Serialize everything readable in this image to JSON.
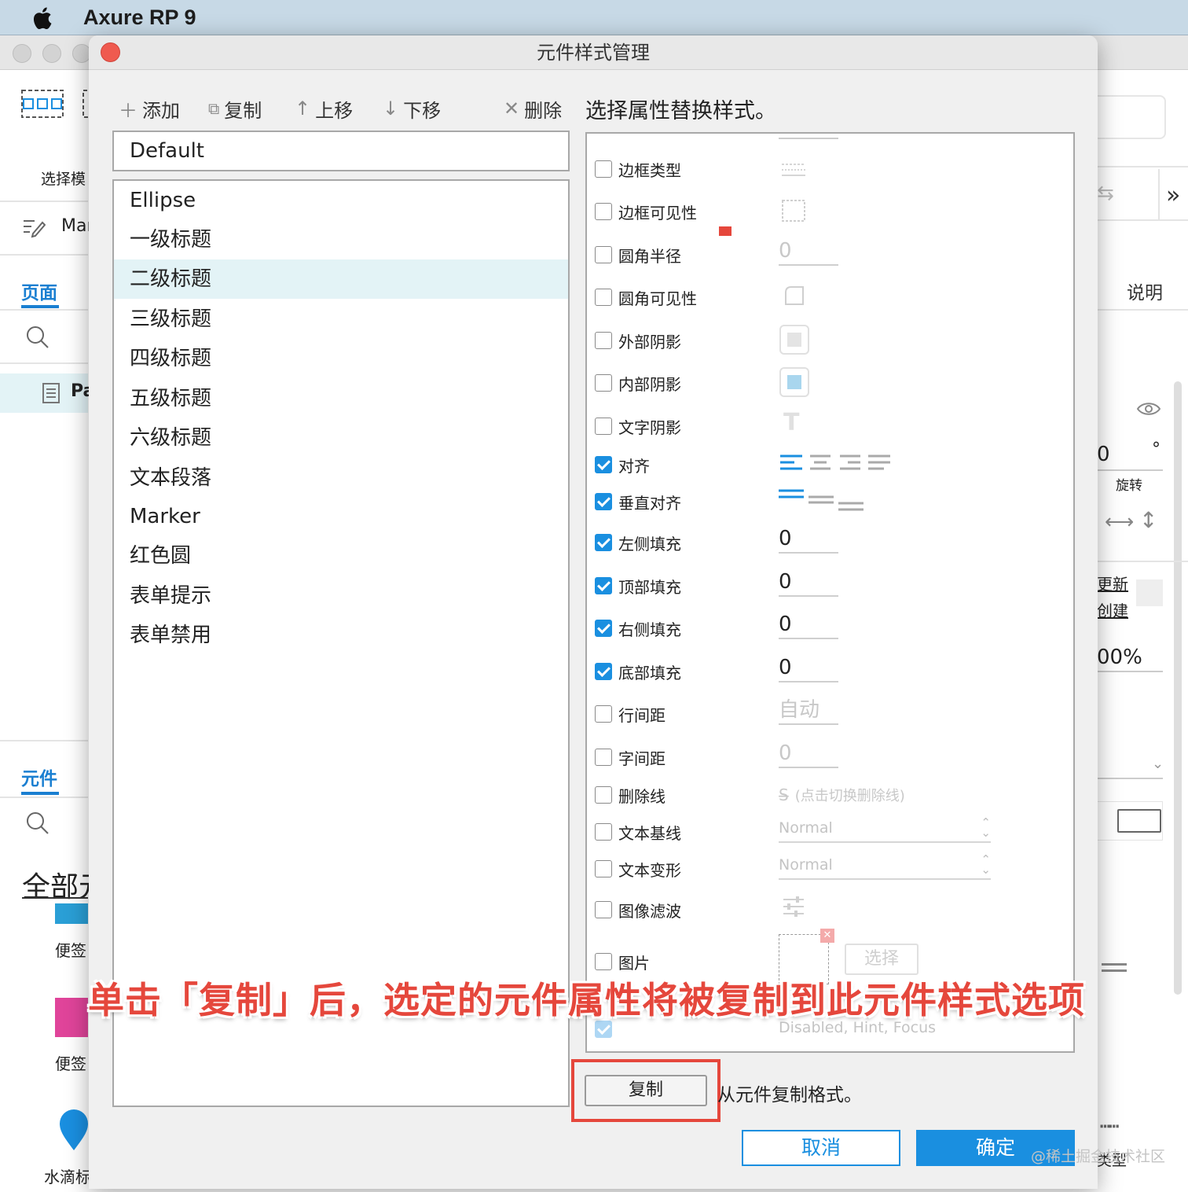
{
  "menubar": {
    "app_name": "Axure RP 9"
  },
  "left_pane": {
    "select_mode_label": "选择模",
    "marker_label": "Mar",
    "pages_tab": "页面",
    "page_item": "Pa",
    "components_tab": "元件",
    "all_components": "全部元",
    "sticky1": "便签",
    "sticky2": "便签",
    "water_drop": "水滴标"
  },
  "right_pane": {
    "notes_tab": "说明",
    "rotate_value": "0",
    "rotate_unit": "°",
    "rotate_label": "旋转",
    "update_link": "更新",
    "create_link": "创建",
    "opacity": "00%",
    "type_label": "类型"
  },
  "dialog": {
    "title": "元件样式管理",
    "toolbar": {
      "add": "添加",
      "copy": "复制",
      "move_up": "上移",
      "move_down": "下移",
      "delete": "删除"
    },
    "default_style": "Default",
    "styles": [
      "Ellipse",
      "一级标题",
      "二级标题",
      "三级标题",
      "四级标题",
      "五级标题",
      "六级标题",
      "文本段落",
      "Marker",
      "红色圆",
      "表单提示",
      "表单禁用"
    ],
    "selected_index": 2,
    "section_title": "选择属性替换样式。",
    "props": {
      "border_type": "边框类型",
      "border_visibility": "边框可见性",
      "corner_radius": "圆角半径",
      "corner_radius_value": "0",
      "corner_visibility": "圆角可见性",
      "outer_shadow": "外部阴影",
      "inner_shadow": "内部阴影",
      "text_shadow": "文字阴影",
      "align": "对齐",
      "valign": "垂直对齐",
      "padding_left": "左侧填充",
      "padding_left_value": "0",
      "padding_top": "顶部填充",
      "padding_top_value": "0",
      "padding_right": "右侧填充",
      "padding_right_value": "0",
      "padding_bottom": "底部填充",
      "padding_bottom_value": "0",
      "line_spacing": "行间距",
      "line_spacing_value": "自动",
      "char_spacing": "字间距",
      "char_spacing_value": "0",
      "strikethrough": "删除线",
      "strikethrough_hint": "(点击切换删除线)",
      "baseline": "文本基线",
      "baseline_value": "Normal",
      "transform": "文本变形",
      "transform_value": "Normal",
      "image_filter": "图像滤波",
      "image": "图片",
      "image_select": "选择",
      "states_value": "Disabled, Hint, Focus"
    },
    "copy_button": "复制",
    "copy_hint": "从元件复制格式。",
    "cancel": "取消",
    "ok": "确定"
  },
  "annotation": "单击「复制」后，选定的元件属性将被复制到此元件样式选项",
  "watermark": "@稀土掘金技术社区",
  "colors": {
    "accent": "#1a8fe0",
    "annotation": "#e5473c",
    "selected_row": "#e3f3f6",
    "close": "#ef5a4f"
  }
}
